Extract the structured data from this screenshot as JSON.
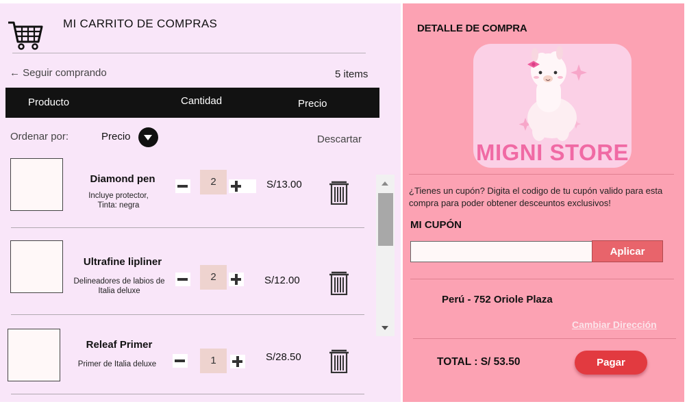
{
  "cart": {
    "title": "MI CARRITO DE COMPRAS",
    "back_label": "← Seguir comprando",
    "items_count": "5 items",
    "columns": [
      "Producto",
      "Cantidad",
      "Precio"
    ],
    "sort_label": "Ordenar por:",
    "sort_value": "Precio",
    "discard_label": "Descartar",
    "items": [
      {
        "name": "Diamond pen",
        "desc": "Incluye protector,\nTinta: negra",
        "qty": "2",
        "price": "S/13.00"
      },
      {
        "name": "Ultrafine lipliner",
        "desc": "Delineadores de labios de\nItalia deluxe",
        "qty": "2",
        "price": "S/12.00"
      },
      {
        "name": "Releaf Primer",
        "desc": "Primer de Italia deluxe",
        "qty": "1",
        "price": "S/28.50"
      }
    ]
  },
  "detail": {
    "title": "DETALLE DE COMPRA",
    "logo_text": "MIGNI STORE",
    "coupon_info": "¿Tienes un cupón?  Digita el codigo de tu cupón valido para esta compra para poder obtener desceuntos exclusivos!",
    "coupon_label": "MI CUPÓN",
    "coupon_value": "",
    "apply_label": "Aplicar",
    "address": "Perú - 752 Oriole Plaza",
    "change_address_label": "Cambiar  Dirección",
    "total": "TOTAL : S/ 53.50",
    "pay_label": "Pagar"
  },
  "colors": {
    "cart_bg": "#f9e6f9",
    "detail_bg": "#fca2b3",
    "table_header": "#121212",
    "apply_button": "#e8646b",
    "pay_button": "#e23a40",
    "logo_text": "#f06aa4"
  },
  "icons": [
    "shopping-cart-icon",
    "trash-icon",
    "chevron-down-icon",
    "plus-icon",
    "minus-icon"
  ]
}
